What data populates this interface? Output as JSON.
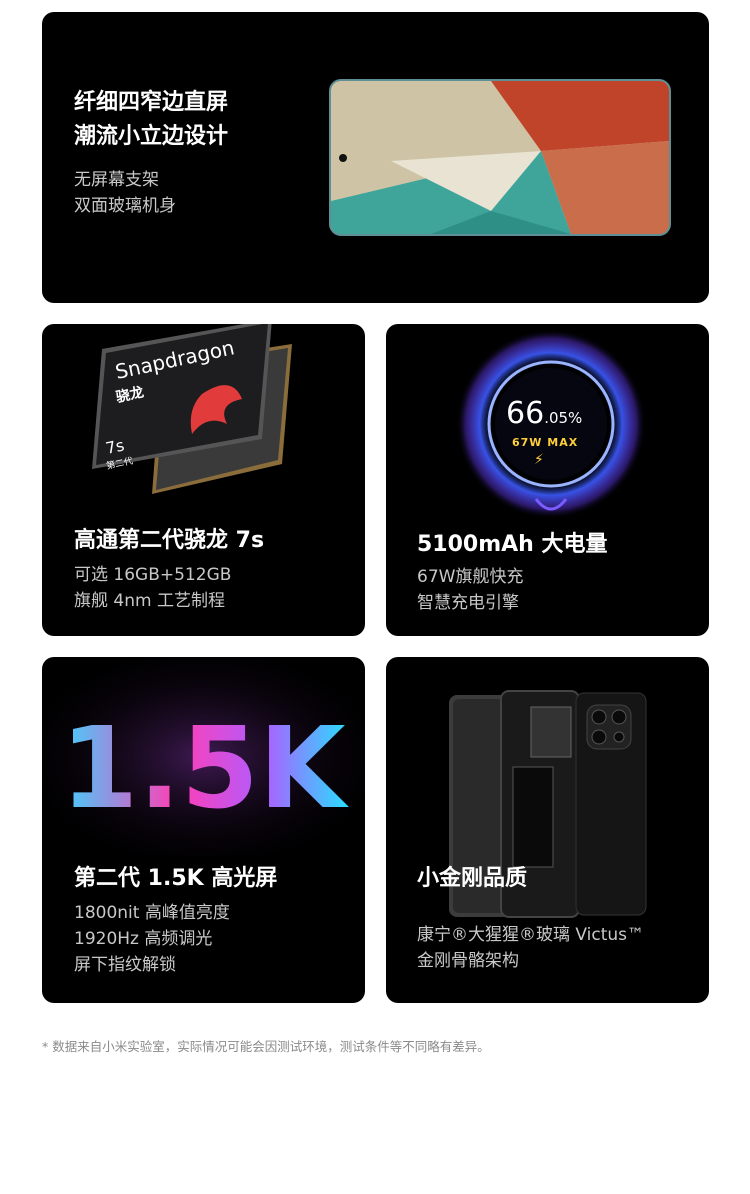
{
  "sections": {
    "top": {
      "title_line1": "纤细四窄边直屏",
      "title_line2": "潮流小立边设计",
      "sub_line1": "无屏幕支架",
      "sub_line2": "双面玻璃机身"
    },
    "chip": {
      "title": "高通第二代骁龙 7s",
      "sub_line1": "可选 16GB+512GB",
      "sub_line2": "旗舰 4nm 工艺制程",
      "chip_brand": "Snapdragon",
      "chip_brand_cn": "骁龙",
      "chip_model": "7s",
      "chip_gen": "第二代"
    },
    "battery": {
      "title": "5100mAh 大电量",
      "sub_line1": "67W旗舰快充",
      "sub_line2": "智慧充电引擎",
      "charge_value": "66",
      "charge_decimal": ".05%",
      "charge_watt": "67W MAX",
      "bolt_icon": "⚡"
    },
    "display": {
      "title": "第二代 1.5K 高光屏",
      "sub_line1": "1800nit 高峰值亮度",
      "sub_line2": "1920Hz 高频调光",
      "sub_line3": "屏下指纹解锁",
      "hero_text": "1.5K"
    },
    "body": {
      "title": "小金刚品质",
      "sub_line1": "康宁®大猩猩®玻璃 Victus™",
      "sub_line2": "金刚骨骼架构"
    }
  },
  "footnote": "* 数据来自小米实验室，实际情况可能会因测试环境，测试条件等不同略有差异。",
  "colors": {
    "card_bg": "#000000",
    "page_bg": "#ffffff",
    "accent_yellow": "#ffcf3a",
    "ring_blue": "#4a6cff"
  }
}
